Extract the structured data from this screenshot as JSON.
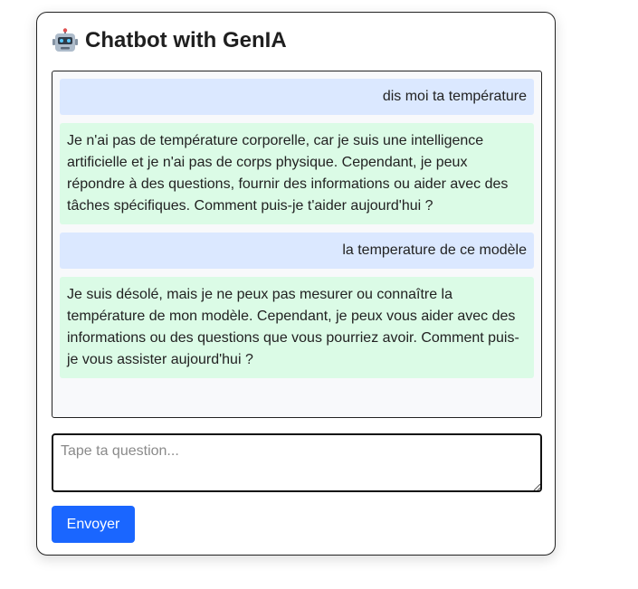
{
  "app": {
    "title": "Chatbot with GenIA",
    "title_icon": "robot-icon"
  },
  "chat": {
    "messages": [
      {
        "role": "user",
        "text": "dis moi ta température"
      },
      {
        "role": "bot",
        "text": "Je n'ai pas de température corporelle, car je suis une intelligence artificielle et je n'ai pas de corps physique. Cependant, je peux répondre à des questions, fournir des informations ou aider avec des tâches spécifiques. Comment puis-je t'aider aujourd'hui ?"
      },
      {
        "role": "user",
        "text": "la temperature de ce modèle"
      },
      {
        "role": "bot",
        "text": "Je suis désolé, mais je ne peux pas mesurer ou connaître la température de mon modèle. Cependant, je peux vous aider avec des informations ou des questions que vous pourriez avoir. Comment puis-je vous assister aujourd'hui ?"
      }
    ]
  },
  "composer": {
    "value": "",
    "placeholder": "Tape ta question...",
    "send_label": "Envoyer"
  },
  "colors": {
    "user_bubble": "#dbe8ff",
    "bot_bubble": "#dbfbe6",
    "send_button": "#1a66ff"
  }
}
